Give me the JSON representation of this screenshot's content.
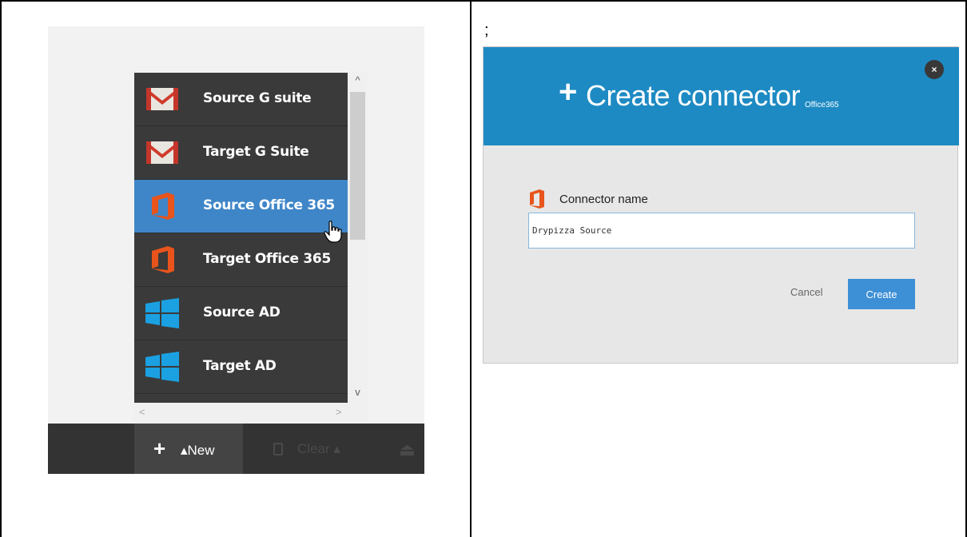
{
  "left": {
    "menu_items": [
      {
        "label": "Source G suite",
        "icon": "gmail-icon"
      },
      {
        "label": "Target G Suite",
        "icon": "gmail-icon"
      },
      {
        "label": "Source Office 365",
        "icon": "office365-icon",
        "active": true
      },
      {
        "label": "Target Office 365",
        "icon": "office365-icon"
      },
      {
        "label": "Source AD",
        "icon": "windows-icon"
      },
      {
        "label": "Target AD",
        "icon": "windows-icon"
      }
    ],
    "scroll_up": "^",
    "scroll_down": "v",
    "scroll_left": "<",
    "scroll_right": ">",
    "toolbar": {
      "new_plus": "+",
      "new_label": "▴New",
      "clear_label": "Clear ▴"
    },
    "colors": {
      "active": "#3f86c8",
      "menu_bg": "#3a3a3a",
      "toolbar_bg": "#333333"
    }
  },
  "right": {
    "separator": ";",
    "dialog": {
      "close": "×",
      "title_plus": "+",
      "title": "Create connector",
      "subtitle": "Office365",
      "field_label": "Connector name",
      "field_value": "Drypizza Source",
      "cancel_label": "Cancel",
      "create_label": "Create"
    },
    "colors": {
      "header": "#1e8ac3",
      "button": "#3d8fd6",
      "body": "#e7e7e7"
    }
  }
}
